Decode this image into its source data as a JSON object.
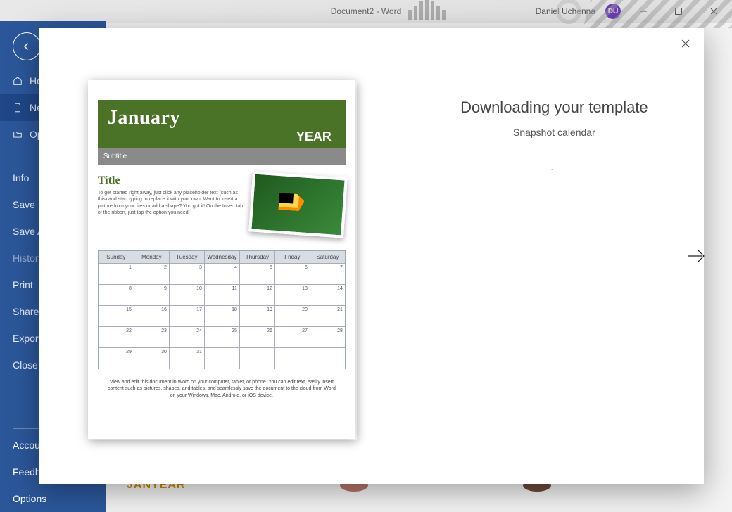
{
  "titlebar": {
    "document_title": "Document2 - Word",
    "user_name": "Daniel Uchenna",
    "user_initials": "DU"
  },
  "sidebar": {
    "items": [
      {
        "label": "Home"
      },
      {
        "label": "New"
      },
      {
        "label": "Open"
      },
      {
        "label": "Info"
      },
      {
        "label": "Save"
      },
      {
        "label": "Save As"
      },
      {
        "label": "History"
      },
      {
        "label": "Print"
      },
      {
        "label": "Share"
      },
      {
        "label": "Export"
      },
      {
        "label": "Close"
      }
    ],
    "divider_then": [
      {
        "label": "Account"
      },
      {
        "label": "Feedback"
      },
      {
        "label": "Options"
      }
    ]
  },
  "modal": {
    "heading": "Downloading your template",
    "template_name": "Snapshot calendar"
  },
  "preview": {
    "month": "January",
    "year_label": "YEAR",
    "subtitle_label": "Subtitle",
    "title_label": "Title",
    "body_text": "To get started right away, just click any placeholder text (such as this) and start typing to replace it with your own. Want to insert a picture from your files or add a shape? You got it! On the Insert tab of the ribbon, just tap the option you need.",
    "days": [
      "Sunday",
      "Monday",
      "Tuesday",
      "Wednesday",
      "Thursday",
      "Friday",
      "Saturday"
    ],
    "footer_text": "View and edit this document in Word on your computer, tablet, or phone. You can edit text, easily insert content such as pictures, shapes, and tables, and seamlessly save the document to the cloud from Word on your Windows, Mac, Android, or iOS device."
  },
  "behind": {
    "t1": "JANYEAR"
  }
}
